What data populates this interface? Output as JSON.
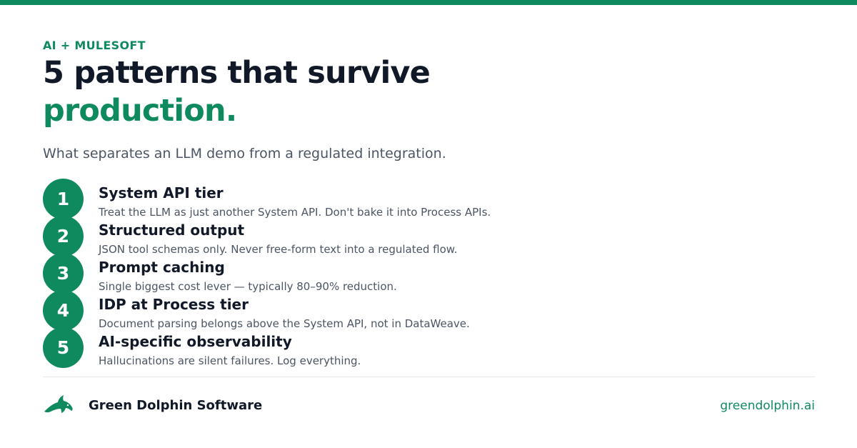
{
  "colors": {
    "accent": "#0f8a5f",
    "heading": "#111827",
    "muted": "#4b5563",
    "divider": "#e5e7eb"
  },
  "eyebrow": "AI + MULESOFT",
  "headline": {
    "line1": "5 patterns that survive",
    "line2": "production."
  },
  "subtitle": "What separates an LLM demo from a regulated integration.",
  "items": [
    {
      "number": "1",
      "title": "System API tier",
      "description": "Treat the LLM as just another System API. Don't bake it into Process APIs."
    },
    {
      "number": "2",
      "title": "Structured output",
      "description": "JSON tool schemas only. Never free-form text into a regulated flow."
    },
    {
      "number": "3",
      "title": "Prompt caching",
      "description": "Single biggest cost lever — typically 80–90% reduction."
    },
    {
      "number": "4",
      "title": "IDP at Process tier",
      "description": "Document parsing belongs above the System API, not in DataWeave."
    },
    {
      "number": "5",
      "title": "AI-specific observability",
      "description": "Hallucinations are silent failures. Log everything."
    }
  ],
  "footer": {
    "logo_icon": "dolphin-logo-icon",
    "brand_name": "Green Dolphin Software",
    "website": "greendolphin.ai"
  }
}
